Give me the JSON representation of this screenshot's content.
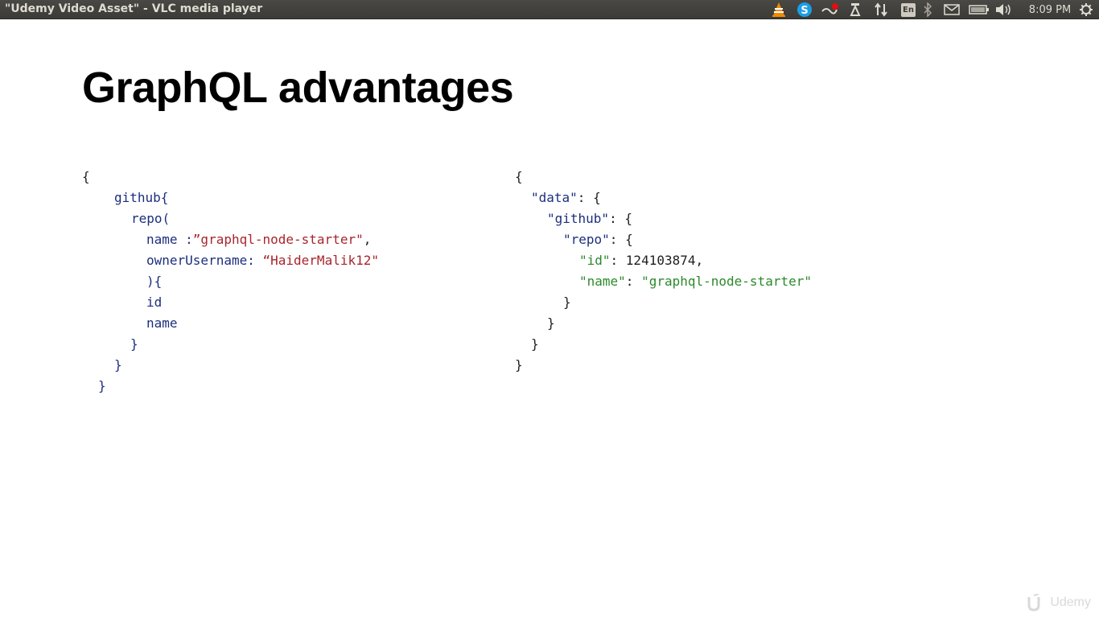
{
  "window": {
    "title": "\"Udemy Video Asset\" - VLC media player"
  },
  "tray": {
    "icons": [
      "vlc-icon",
      "skype-icon",
      "network-icon",
      "update-icon",
      "transfer-icon",
      "keyboard-layout-icon",
      "bluetooth-icon",
      "mail-icon",
      "battery-icon",
      "volume-icon",
      "gear-icon"
    ],
    "keyboard_layout": "En",
    "clock": "8:09 PM"
  },
  "slide": {
    "title": "GraphQL advantages",
    "query": {
      "l1": "{",
      "l2": "github{",
      "l3": "repo(",
      "l4_key": "name :",
      "l4_val": "”graphql-node-starter\"",
      "l4_end": ",",
      "l5_key": "ownerUsername:",
      "l5_val": "“HaiderMalik12\"",
      "l6": "){",
      "l7": "id",
      "l8": "name",
      "l9": "}",
      "l10": "}",
      "l11": "}"
    },
    "response": {
      "l1": "{",
      "l2_key": "\"data\"",
      "l2_end": ": {",
      "l3_key": "\"github\"",
      "l3_end": ": {",
      "l4_key": "\"repo\"",
      "l4_end": ": {",
      "l5_key": "\"id\"",
      "l5_end": ": 124103874,",
      "l6_key": "\"name\"",
      "l6_sep": ": ",
      "l6_val": "\"graphql-node-starter\"",
      "l7": "}",
      "l8": "}",
      "l9": "}",
      "l10": "}"
    }
  },
  "watermark": {
    "text": "Udemy"
  },
  "colors": {
    "keyword": "#1c2f7d",
    "string_red": "#a8252d",
    "string_green": "#2b8a2b",
    "topbar": "#3c3b37"
  }
}
